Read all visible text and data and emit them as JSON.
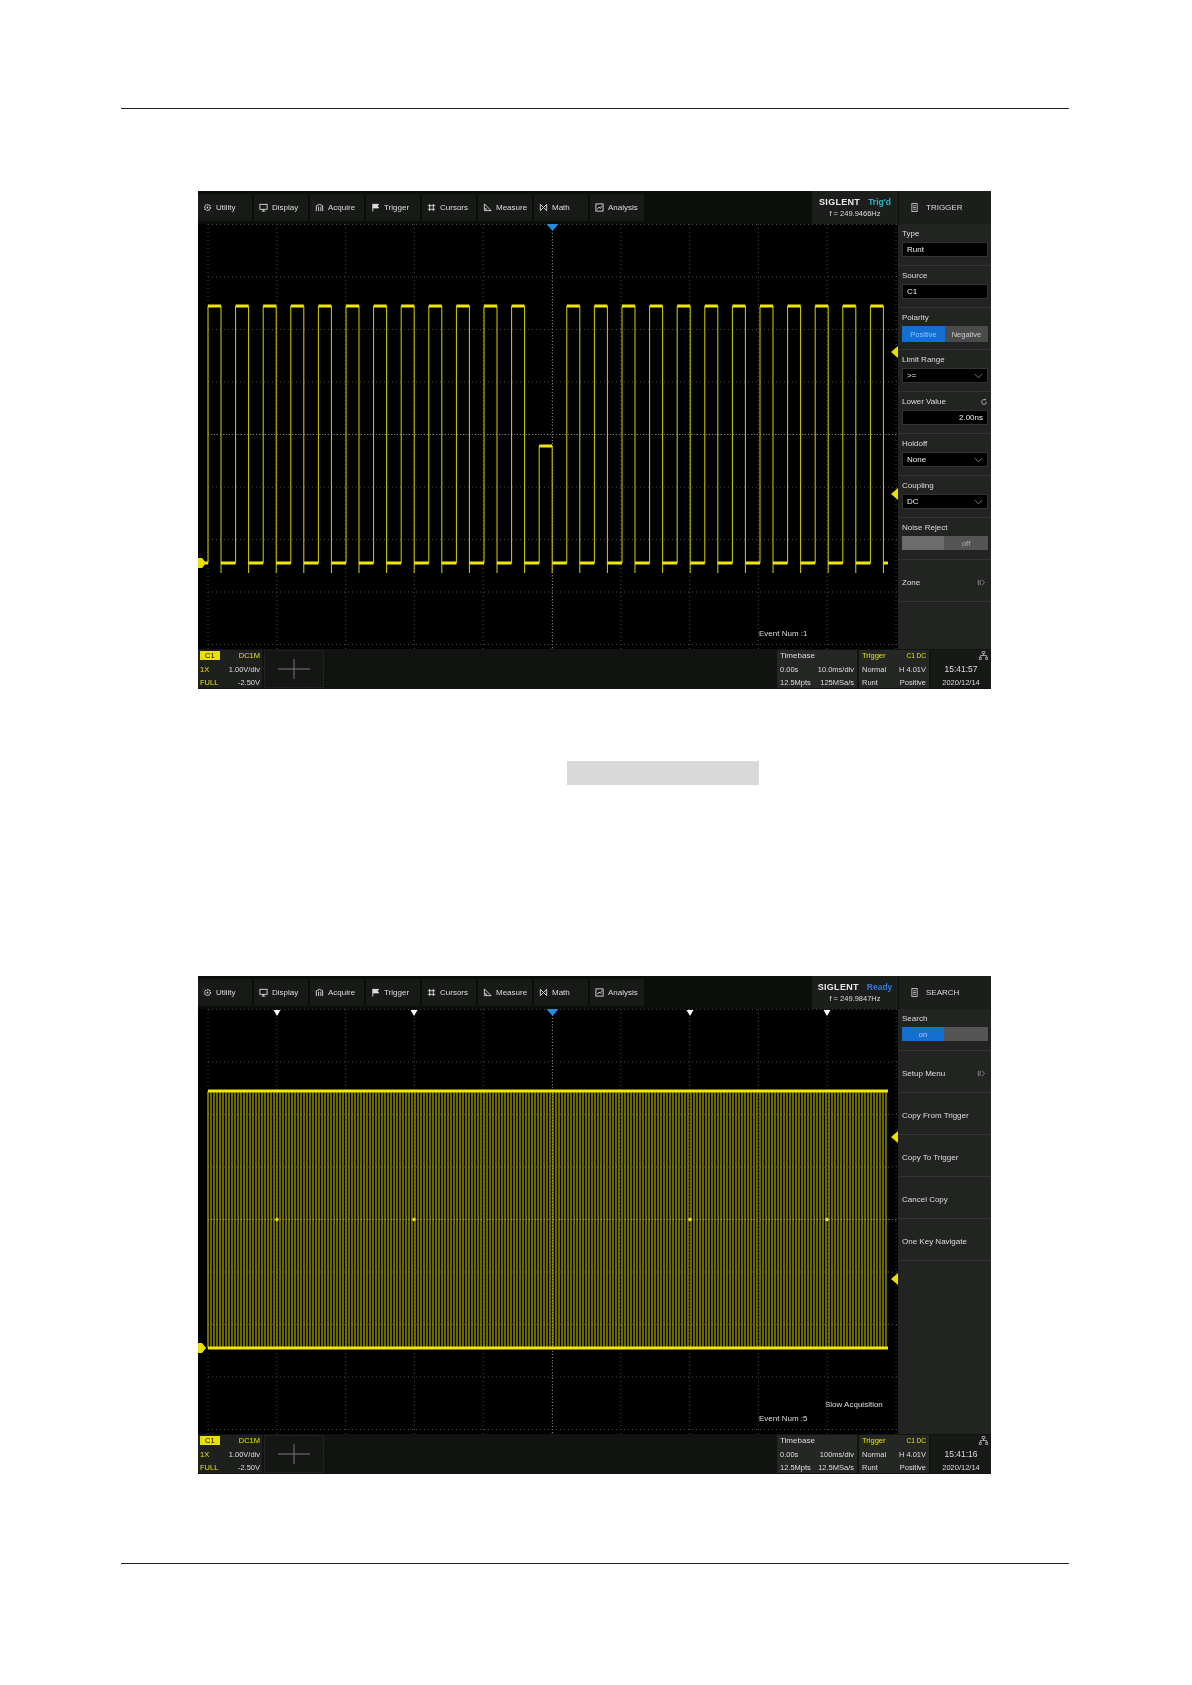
{
  "screens": [
    {
      "menu": [
        "Utility",
        "Display",
        "Acquire",
        "Trigger",
        "Cursors",
        "Measure",
        "Math",
        "Analysis"
      ],
      "brand": "SIGLENT",
      "status": {
        "text": "Trig'd",
        "color": "#2bb8c8"
      },
      "frequency": "f = 249.9466Hz",
      "panel_title": "TRIGGER",
      "panel": [
        {
          "kind": "field",
          "label": "Type",
          "value": "Runt"
        },
        {
          "kind": "field",
          "label": "Source",
          "value": "C1"
        },
        {
          "kind": "segmented",
          "label": "Polarity",
          "options": [
            {
              "label": "Positive",
              "selected": true
            },
            {
              "label": "Negative",
              "selected": false
            }
          ]
        },
        {
          "kind": "dropdown",
          "label": "Limit Range",
          "value": ">="
        },
        {
          "kind": "number",
          "label": "Lower Value",
          "value": "2.00ns"
        },
        {
          "kind": "dropdown",
          "label": "Holdoff",
          "value": "None"
        },
        {
          "kind": "dropdown",
          "label": "Coupling",
          "value": "DC"
        },
        {
          "kind": "toggle",
          "label": "Noise Reject",
          "on": false,
          "text": "off"
        },
        {
          "kind": "submenu",
          "label": "Zone"
        }
      ],
      "trace": {
        "kind": "runt"
      },
      "notes": [
        {
          "kind": "event",
          "text": "Event Num :1"
        }
      ],
      "channel": {
        "name": "C1",
        "coupling": "DC1M",
        "probe": "1X",
        "scale": "1.00V/div",
        "bandwidth": "FULL",
        "offset": "-2.50V"
      },
      "timebase": {
        "title": "Timebase",
        "delay": "0.00s",
        "scale": "10.0ms/div",
        "depth": "12.5Mpts",
        "rate": "125MSa/s"
      },
      "trigger": {
        "title": "Trigger",
        "source": "C1 DC",
        "mode": "Normal",
        "level": "H 4.01V",
        "type": "Runt",
        "polarity": "Positive"
      },
      "time": "15:41:57",
      "date": "2020/12/14"
    },
    {
      "menu": [
        "Utility",
        "Display",
        "Acquire",
        "Trigger",
        "Cursors",
        "Measure",
        "Math",
        "Analysis"
      ],
      "brand": "SIGLENT",
      "status": {
        "text": "Ready",
        "color": "#2f7ad8"
      },
      "frequency": "f = 249.9847Hz",
      "panel_title": "SEARCH",
      "panel": [
        {
          "kind": "toggle",
          "label": "Search",
          "on": true,
          "text": "on"
        },
        {
          "kind": "submenu",
          "label": "Setup Menu"
        },
        {
          "kind": "action",
          "label": "Copy From Trigger"
        },
        {
          "kind": "action",
          "label": "Copy To Trigger"
        },
        {
          "kind": "action",
          "label": "Cancel Copy"
        },
        {
          "kind": "action",
          "label": "One Key Navigate"
        }
      ],
      "trace": {
        "kind": "dense"
      },
      "notes": [
        {
          "kind": "acquisition",
          "text": "Slow Acquisition"
        },
        {
          "kind": "event",
          "text": "Event Num :5"
        }
      ],
      "channel": {
        "name": "C1",
        "coupling": "DC1M",
        "probe": "1X",
        "scale": "1.00V/div",
        "bandwidth": "FULL",
        "offset": "-2.50V"
      },
      "timebase": {
        "title": "Timebase",
        "delay": "0.00s",
        "scale": "100ms/div",
        "depth": "12.5Mpts",
        "rate": "12.5MSa/s"
      },
      "trigger": {
        "title": "Trigger",
        "source": "C1 DC",
        "mode": "Normal",
        "level": "H 4.01V",
        "type": "Runt",
        "polarity": "Positive"
      },
      "time": "15:41:16",
      "date": "2020/12/14"
    }
  ]
}
